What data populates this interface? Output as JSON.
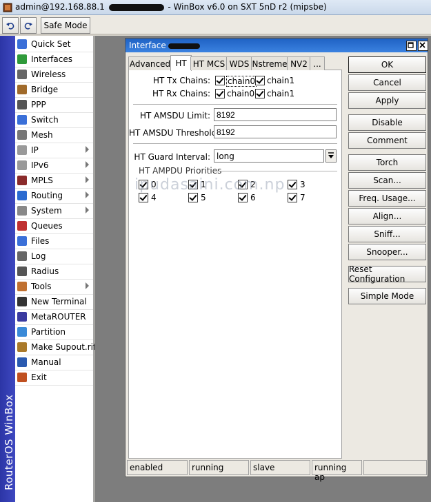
{
  "window": {
    "title_prefix": "admin@192.168.88.1",
    "title_suffix": "- WinBox v6.0 on SXT 5nD r2 (mipsbe)"
  },
  "toolbar": {
    "safe_mode_label": "Safe Mode"
  },
  "brand": "RouterOS WinBox",
  "sidebar": {
    "items": [
      {
        "label": "Quick Set",
        "icon": "quickset-icon",
        "submenu": false
      },
      {
        "label": "Interfaces",
        "icon": "interfaces-icon",
        "submenu": false
      },
      {
        "label": "Wireless",
        "icon": "wireless-icon",
        "submenu": false
      },
      {
        "label": "Bridge",
        "icon": "bridge-icon",
        "submenu": false
      },
      {
        "label": "PPP",
        "icon": "ppp-icon",
        "submenu": false
      },
      {
        "label": "Switch",
        "icon": "switch-icon",
        "submenu": false
      },
      {
        "label": "Mesh",
        "icon": "mesh-icon",
        "submenu": false
      },
      {
        "label": "IP",
        "icon": "ip-icon",
        "submenu": true
      },
      {
        "label": "IPv6",
        "icon": "ipv6-icon",
        "submenu": true
      },
      {
        "label": "MPLS",
        "icon": "mpls-icon",
        "submenu": true
      },
      {
        "label": "Routing",
        "icon": "routing-icon",
        "submenu": true
      },
      {
        "label": "System",
        "icon": "system-icon",
        "submenu": true
      },
      {
        "label": "Queues",
        "icon": "queues-icon",
        "submenu": false
      },
      {
        "label": "Files",
        "icon": "files-icon",
        "submenu": false
      },
      {
        "label": "Log",
        "icon": "log-icon",
        "submenu": false
      },
      {
        "label": "Radius",
        "icon": "radius-icon",
        "submenu": false
      },
      {
        "label": "Tools",
        "icon": "tools-icon",
        "submenu": true
      },
      {
        "label": "New Terminal",
        "icon": "terminal-icon",
        "submenu": false
      },
      {
        "label": "MetaROUTER",
        "icon": "metarouter-icon",
        "submenu": false
      },
      {
        "label": "Partition",
        "icon": "partition-icon",
        "submenu": false
      },
      {
        "label": "Make Supout.rif",
        "icon": "supout-icon",
        "submenu": false
      },
      {
        "label": "Manual",
        "icon": "manual-icon",
        "submenu": false
      },
      {
        "label": "Exit",
        "icon": "exit-icon",
        "submenu": false
      }
    ]
  },
  "dialog": {
    "title": "Interface",
    "tabs": [
      "Advanced",
      "HT",
      "HT MCS",
      "WDS",
      "Nstreme",
      "NV2",
      "..."
    ],
    "active_tab": "HT",
    "ht_tx_chains_label": "HT Tx Chains:",
    "ht_rx_chains_label": "HT Rx Chains:",
    "chain0": "chain0",
    "chain1": "chain1",
    "amsdu_limit_label": "HT AMSDU Limit:",
    "amsdu_limit_value": "8192",
    "amsdu_threshold_label": "HT AMSDU Threshold:",
    "amsdu_threshold_value": "8192",
    "guard_interval_label": "HT Guard Interval:",
    "guard_interval_value": "long",
    "ampdu_label": "HT AMPDU Priorities",
    "ampdu_priorities": [
      "0",
      "1",
      "2",
      "3",
      "4",
      "5",
      "6",
      "7"
    ],
    "buttons": [
      "OK",
      "Cancel",
      "Apply",
      "Disable",
      "Comment",
      "Torch",
      "Scan...",
      "Freq. Usage...",
      "Align...",
      "Sniff...",
      "Snooper...",
      "Reset Configuration",
      "Simple Mode"
    ],
    "status": [
      "enabled",
      "running",
      "slave",
      "running ap",
      ""
    ]
  },
  "watermark": "ipudasaini.com.np",
  "colors": {
    "title_bar": "#2a6ed0",
    "brand_strip": "#3540b0",
    "workspace": "#7d7d7d"
  }
}
